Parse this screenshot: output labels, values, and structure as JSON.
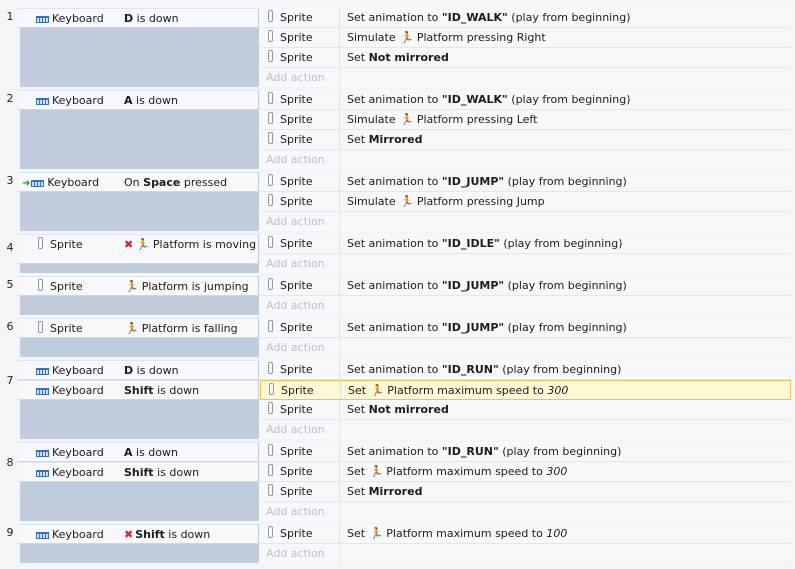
{
  "events": [
    {
      "number": "1",
      "conditions": [
        {
          "object": "Keyboard",
          "icon": "keyboard-icon",
          "parts": [
            {
              "t": "D",
              "b": 1
            },
            {
              "t": " is down"
            }
          ]
        }
      ],
      "actions": [
        {
          "object": "Sprite",
          "parts": [
            {
              "t": "Set animation to "
            },
            {
              "t": "\"ID_WALK\"",
              "b": 1
            },
            {
              "t": " (play from beginning)"
            }
          ]
        },
        {
          "object": "Sprite",
          "parts": [
            {
              "t": "Simulate "
            },
            {
              "icon": "platform-icon"
            },
            {
              "t": "Platform pressing Right"
            }
          ]
        },
        {
          "object": "Sprite",
          "parts": [
            {
              "t": "Set "
            },
            {
              "t": "Not mirrored",
              "b": 1
            }
          ]
        }
      ],
      "add_action": "Add action"
    },
    {
      "number": "2",
      "conditions": [
        {
          "object": "Keyboard",
          "icon": "keyboard-icon",
          "parts": [
            {
              "t": "A",
              "b": 1
            },
            {
              "t": " is down"
            }
          ]
        }
      ],
      "actions": [
        {
          "object": "Sprite",
          "parts": [
            {
              "t": "Set animation to "
            },
            {
              "t": "\"ID_WALK\"",
              "b": 1
            },
            {
              "t": " (play from beginning)"
            }
          ]
        },
        {
          "object": "Sprite",
          "parts": [
            {
              "t": "Simulate "
            },
            {
              "icon": "platform-icon"
            },
            {
              "t": "Platform pressing Left"
            }
          ]
        },
        {
          "object": "Sprite",
          "parts": [
            {
              "t": "Set "
            },
            {
              "t": "Mirrored",
              "b": 1
            }
          ]
        }
      ],
      "add_action": "Add action"
    },
    {
      "number": "3",
      "trigger": true,
      "conditions": [
        {
          "object": "Keyboard",
          "icon": "keyboard-icon",
          "parts": [
            {
              "t": "On "
            },
            {
              "t": "Space",
              "b": 1
            },
            {
              "t": " pressed"
            }
          ]
        }
      ],
      "actions": [
        {
          "object": "Sprite",
          "parts": [
            {
              "t": "Set animation to "
            },
            {
              "t": "\"ID_JUMP\"",
              "b": 1
            },
            {
              "t": " (play from beginning)"
            }
          ]
        },
        {
          "object": "Sprite",
          "parts": [
            {
              "t": "Simulate "
            },
            {
              "icon": "platform-icon"
            },
            {
              "t": "Platform pressing Jump"
            }
          ]
        }
      ],
      "add_action": "Add action"
    },
    {
      "number": "4",
      "conditions": [
        {
          "object": "Sprite",
          "icon": "sprite-icon",
          "inverted": true,
          "two_line": true,
          "parts": [
            {
              "icon": "platform-icon"
            },
            {
              "t": "Platform is moving"
            }
          ]
        }
      ],
      "actions": [
        {
          "object": "Sprite",
          "parts": [
            {
              "t": "Set animation to "
            },
            {
              "t": "\"ID_IDLE\"",
              "b": 1
            },
            {
              "t": " (play from beginning)"
            }
          ]
        }
      ],
      "add_action": "Add action"
    },
    {
      "number": "5",
      "conditions": [
        {
          "object": "Sprite",
          "icon": "sprite-icon",
          "parts": [
            {
              "icon": "platform-icon"
            },
            {
              "t": "Platform is jumping"
            }
          ]
        }
      ],
      "actions": [
        {
          "object": "Sprite",
          "parts": [
            {
              "t": "Set animation to "
            },
            {
              "t": "\"ID_JUMP\"",
              "b": 1
            },
            {
              "t": " (play from beginning)"
            }
          ]
        }
      ],
      "add_action": "Add action"
    },
    {
      "number": "6",
      "conditions": [
        {
          "object": "Sprite",
          "icon": "sprite-icon",
          "parts": [
            {
              "icon": "platform-icon"
            },
            {
              "t": "Platform is falling"
            }
          ]
        }
      ],
      "actions": [
        {
          "object": "Sprite",
          "parts": [
            {
              "t": "Set animation to "
            },
            {
              "t": "\"ID_JUMP\"",
              "b": 1
            },
            {
              "t": " (play from beginning)"
            }
          ]
        }
      ],
      "add_action": "Add action"
    },
    {
      "number": "7",
      "conditions": [
        {
          "object": "Keyboard",
          "icon": "keyboard-icon",
          "parts": [
            {
              "t": "D",
              "b": 1
            },
            {
              "t": " is down"
            }
          ]
        },
        {
          "object": "Keyboard",
          "icon": "keyboard-icon",
          "parts": [
            {
              "t": "Shift",
              "b": 1
            },
            {
              "t": " is down"
            }
          ]
        }
      ],
      "actions": [
        {
          "object": "Sprite",
          "parts": [
            {
              "t": "Set animation to "
            },
            {
              "t": "\"ID_RUN\"",
              "b": 1
            },
            {
              "t": " (play from beginning)"
            }
          ]
        },
        {
          "object": "Sprite",
          "selected": true,
          "parts": [
            {
              "t": "Set "
            },
            {
              "icon": "platform-icon"
            },
            {
              "t": "Platform maximum speed to "
            },
            {
              "t": "300",
              "i": 1
            }
          ]
        },
        {
          "object": "Sprite",
          "parts": [
            {
              "t": "Set "
            },
            {
              "t": "Not mirrored",
              "b": 1
            }
          ]
        }
      ],
      "add_action": "Add action"
    },
    {
      "number": "8",
      "conditions": [
        {
          "object": "Keyboard",
          "icon": "keyboard-icon",
          "parts": [
            {
              "t": "A",
              "b": 1
            },
            {
              "t": " is down"
            }
          ]
        },
        {
          "object": "Keyboard",
          "icon": "keyboard-icon",
          "parts": [
            {
              "t": "Shift",
              "b": 1
            },
            {
              "t": " is down"
            }
          ]
        }
      ],
      "actions": [
        {
          "object": "Sprite",
          "parts": [
            {
              "t": "Set animation to "
            },
            {
              "t": "\"ID_RUN\"",
              "b": 1
            },
            {
              "t": " (play from beginning)"
            }
          ]
        },
        {
          "object": "Sprite",
          "parts": [
            {
              "t": "Set "
            },
            {
              "icon": "platform-icon"
            },
            {
              "t": "Platform maximum speed to "
            },
            {
              "t": "300",
              "i": 1
            }
          ]
        },
        {
          "object": "Sprite",
          "parts": [
            {
              "t": "Set "
            },
            {
              "t": "Mirrored",
              "b": 1
            }
          ]
        }
      ],
      "add_action": "Add action"
    },
    {
      "number": "9",
      "conditions": [
        {
          "object": "Keyboard",
          "icon": "keyboard-icon",
          "inverted": true,
          "parts": [
            {
              "t": "Shift",
              "b": 1
            },
            {
              "t": " is down"
            }
          ]
        }
      ],
      "actions": [
        {
          "object": "Sprite",
          "parts": [
            {
              "t": "Set "
            },
            {
              "icon": "platform-icon"
            },
            {
              "t": "Platform maximum speed to "
            },
            {
              "t": "100",
              "i": 1
            }
          ]
        }
      ],
      "add_action": "Add action"
    }
  ]
}
